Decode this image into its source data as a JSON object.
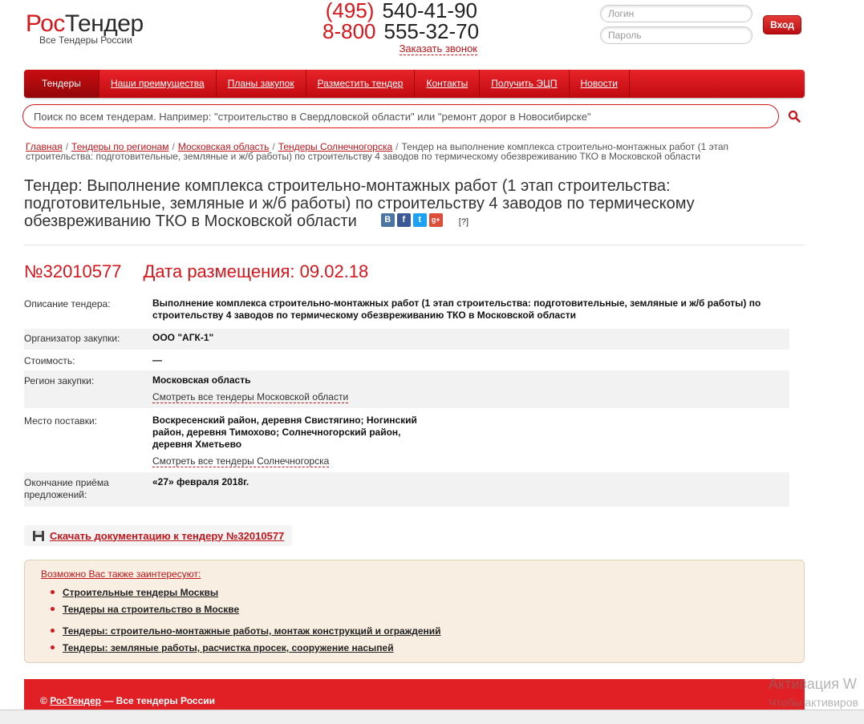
{
  "logo": {
    "part1": "Рос",
    "part2": "Тендер",
    "tagline": "Все Тендеры России"
  },
  "phones": [
    {
      "code": "(495)",
      "number": "540-41-90"
    },
    {
      "code": "8-800",
      "number": "555-32-70"
    }
  ],
  "callback_label": "Заказать звонок",
  "login": {
    "login_placeholder": "Логин",
    "password_placeholder": "Пароль",
    "submit_label": "Вход"
  },
  "nav": [
    "Тендеры",
    "Наши преимущества",
    "Планы закупок",
    "Разместить тендер",
    "Контакты",
    "Получить ЭЦП",
    "Новости"
  ],
  "search": {
    "placeholder": "Поиск по всем тендерам. Например: \"строительство в Свердловской области\" или \"ремонт дорог в Новосибирске\""
  },
  "breadcrumb": [
    "Главная",
    "Тендеры по регионам",
    "Московская область",
    "Тендеры Солнечногорска",
    "Тендер на выполнение комплекса строительно-монтажных работ (1 этап строительства: подготовительные, земляные и ж/б работы) по строительству 4 заводов по термическому обезвреживанию ТКО в Московской области"
  ],
  "title": "Тендер: Выполнение комплекса строительно-монтажных работ (1 этап строительства: подготовительные, земляные и ж/б работы) по строительству 4 заводов по термическому обезвреживанию ТКО в Московской области",
  "share": [
    {
      "glyph": "B",
      "color": "#4c75a3",
      "icon": "vk-icon"
    },
    {
      "glyph": "f",
      "color": "#3b5998",
      "icon": "facebook-icon"
    },
    {
      "glyph": "t",
      "color": "#1da1f2",
      "icon": "twitter-icon"
    },
    {
      "glyph": "g+",
      "color": "#dd4b39",
      "icon": "google-plus-icon"
    }
  ],
  "help_label": "[?]",
  "tender": {
    "number": "№32010577",
    "date_label": "Дата размещения: 09.02.18"
  },
  "info": {
    "description": {
      "label": "Описание тендера:",
      "value": "Выполнение комплекса строительно-монтажных работ (1 этап строительства: подготовительные, земляные и ж/б работы) по строительству 4 заводов по термическому обезвреживанию ТКО в Московской области"
    },
    "organizer": {
      "label": "Организатор закупки:",
      "value": "ООО \"АГК-1\""
    },
    "cost": {
      "label": "Стоимость:",
      "value": "—"
    },
    "region": {
      "label": "Регион закупки:",
      "value": "Московская область",
      "link": "Смотреть все тендеры Московской области"
    },
    "delivery": {
      "label": "Место поставки:",
      "value": "Воскресенский район, деревня Свистягино; Ногинский район, деревня Тимохово; Солнечногорский район, деревня Хметьево",
      "link": "Смотреть все тендеры Солнечногорска"
    },
    "deadline": {
      "label": "Окончание приёма предложений:",
      "value": "«27» февраля 2018г."
    }
  },
  "download_label": "Скачать документацию к тендеру №32010577",
  "related": {
    "title": "Возможно Вас также заинтересуют:",
    "items": [
      "Строительные тендеры Москвы",
      "Тендеры на строительство в Москве",
      "Тендеры: строительно-монтажные работы, монтаж конструкций и ограждений",
      "Тендеры: земляные работы, расчистка просек, сооружение насыпей"
    ]
  },
  "footer": {
    "copyright": "©",
    "brand": "РосТендер",
    "rest": " — Все тендеры России"
  },
  "watermark": {
    "line1": "Активация W",
    "line2": "Чтобы активиров"
  },
  "colors": {
    "brand_red": "#d7161b",
    "related_bg": "#f8eee2"
  }
}
